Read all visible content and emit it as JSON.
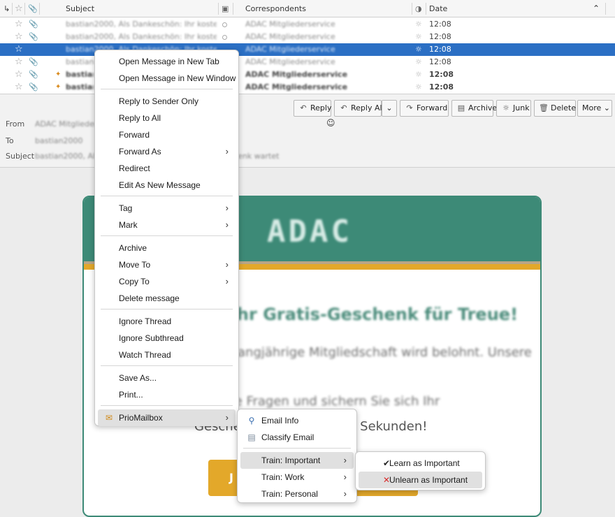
{
  "list": {
    "columns": {
      "subject": "Subject",
      "correspondents": "Correspondents",
      "date": "Date"
    },
    "rows": [
      {
        "subject": "bastian2000, Als Dankeschön: Ihr kostenl...",
        "from": "ADAC Mitgliederservice",
        "date": "12:08",
        "selected": false,
        "unread": false
      },
      {
        "subject": "bastian2000, Als Dankeschön: Ihr kostenl...",
        "from": "ADAC Mitgliederservice",
        "date": "12:08",
        "selected": false,
        "unread": false
      },
      {
        "subject": "bastian2000, Als Dankeschön: Ihr kostenl...",
        "from": "ADAC Mitgliederservice",
        "date": "12:08",
        "selected": true,
        "unread": false
      },
      {
        "subject": "bastian2000, Als Dankeschön",
        "from": "ADAC Mitgliederservice",
        "date": "12:08",
        "selected": false,
        "unread": false
      },
      {
        "subject": "bastian2000, Als",
        "from": "ADAC Mitgliederservice",
        "date": "12:08",
        "selected": false,
        "unread": true
      },
      {
        "subject": "bastian2000, Als",
        "from": "ADAC Mitgliederservice",
        "date": "12:08",
        "selected": false,
        "unread": true
      }
    ]
  },
  "toolbar": {
    "reply": "Reply",
    "reply_all": "Reply All",
    "forward": "Forward",
    "archive": "Archive",
    "junk": "Junk",
    "delete": "Delete",
    "more": "More"
  },
  "headers": {
    "from_label": "From",
    "to_label": "To",
    "subject_label": "Subject",
    "from_value": "ADAC Mitgliederservice",
    "to_value": "bastian2000",
    "subject_value": "bastian2000, Als Dankeschön: Ihr kostenloses Geschenk wartet"
  },
  "email": {
    "logo": "ADAC",
    "heading": "Ihr Gratis-Geschenk für Treue!",
    "line1": "Langjährige Mitgliedschaft wird belohnt. Unsere",
    "line2": "...",
    "line3": "...",
    "line4": "Wenige Fragen und sichern Sie sich Ihr",
    "line5": "Gesche",
    "line5b": "0 Sekunden!",
    "cta": "J"
  },
  "menu": {
    "items": [
      {
        "label": "Open Message in New Tab"
      },
      {
        "label": "Open Message in New Window"
      },
      {
        "label": "Reply to Sender Only"
      },
      {
        "label": "Reply to All"
      },
      {
        "label": "Forward"
      },
      {
        "label": "Forward As"
      },
      {
        "label": "Redirect"
      },
      {
        "label": "Edit As New Message"
      },
      {
        "label": "Tag"
      },
      {
        "label": "Mark"
      },
      {
        "label": "Archive"
      },
      {
        "label": "Move To"
      },
      {
        "label": "Copy To"
      },
      {
        "label": "Delete message"
      },
      {
        "label": "Ignore Thread"
      },
      {
        "label": "Ignore Subthread"
      },
      {
        "label": "Watch Thread"
      },
      {
        "label": "Save As..."
      },
      {
        "label": "Print..."
      },
      {
        "label": "PrioMailbox"
      }
    ]
  },
  "submenu": {
    "items": [
      {
        "label": "Email Info"
      },
      {
        "label": "Classify Email"
      },
      {
        "label": "Train: Important"
      },
      {
        "label": "Train: Work"
      },
      {
        "label": "Train: Personal"
      }
    ]
  },
  "submenu2": {
    "items": [
      {
        "label": "Learn as Important"
      },
      {
        "label": "Unlearn as Important"
      }
    ]
  },
  "colors": {
    "selection": "#2b6fc4",
    "adac_green": "#3d8a77",
    "adac_yellow": "#e3a82a",
    "unlearn_x": "#d62c2c"
  }
}
